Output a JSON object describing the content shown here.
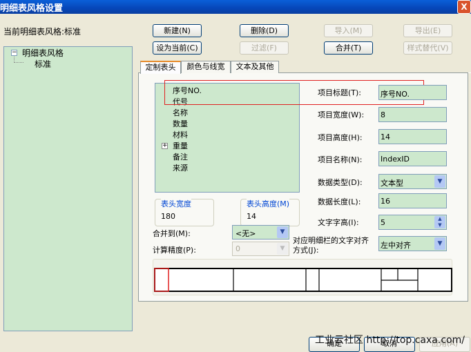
{
  "window": {
    "title": "明细表风格设置",
    "close": "X"
  },
  "current_style_label": "当前明细表风格:标准",
  "buttons": {
    "new": "新建(N)",
    "delete": "删除(D)",
    "import": "导入(M)",
    "export": "导出(E)",
    "set_current": "设为当前(C)",
    "filter": "过滤(F)",
    "merge": "合并(T)",
    "style_replace": "样式替代(V)",
    "ok": "确定",
    "cancel": "取消",
    "apply": "应用(A)"
  },
  "tree": {
    "root": "明细表风格",
    "expander": "−",
    "child": "标准"
  },
  "tabs": [
    "定制表头",
    "颜色与线宽",
    "文本及其他"
  ],
  "columns": [
    "序号NO.",
    "代号",
    "名称",
    "数量",
    "材料",
    "重量",
    "备注",
    "来源"
  ],
  "fields": {
    "title_label": "项目标题(T):",
    "title": "序号NO.",
    "width_label": "项目宽度(W):",
    "width": "8",
    "height_label": "项目高度(H):",
    "height": "14",
    "name_label": "项目名称(N):",
    "name": "IndexID",
    "type_label": "数据类型(D):",
    "type": "文本型",
    "length_label": "数据长度(L):",
    "length": "16",
    "text_height_label": "文字字高(I):",
    "text_height": "5",
    "align_label_1": "对应明细栏的文字对齐",
    "align_label_2": "方式(J):",
    "align": "左中对齐"
  },
  "header_width": {
    "label": "表头宽度",
    "value": "180"
  },
  "header_height": {
    "label": "表头高度(M)",
    "value": "14"
  },
  "merge_to": {
    "label": "合并到(M):",
    "value": "<无>"
  },
  "precision": {
    "label": "计算精度(P):",
    "value": "0"
  },
  "watermark": "工业云社区 http://top.caxa.com/"
}
